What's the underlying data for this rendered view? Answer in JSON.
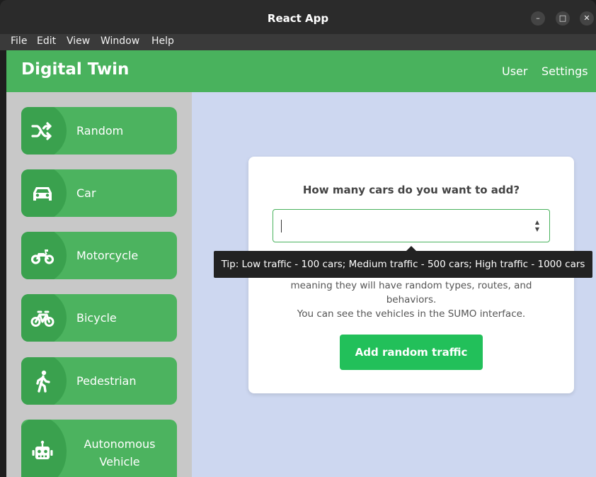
{
  "window": {
    "title": "React App"
  },
  "menu": [
    "File",
    "Edit",
    "View",
    "Window",
    "Help"
  ],
  "header": {
    "brand": "Digital Twin",
    "nav": [
      "User",
      "Settings"
    ]
  },
  "sidebar": {
    "items": [
      {
        "label": "Random",
        "icon": "shuffle-icon"
      },
      {
        "label": "Car",
        "icon": "car-icon"
      },
      {
        "label": "Motorcycle",
        "icon": "motorcycle-icon"
      },
      {
        "label": "Bicycle",
        "icon": "bicycle-icon"
      },
      {
        "label": "Pedestrian",
        "icon": "walking-person-icon"
      },
      {
        "label": "Autonomous Vehicle",
        "icon": "robot-icon"
      }
    ]
  },
  "card": {
    "question": "How many cars do you want to add?",
    "input_value": "",
    "tooltip": "Tip: Low traffic - 100 cars; Medium traffic - 500 cars; High traffic - 1000 cars",
    "description_line1": "meaning they will have random types, routes, and",
    "description_line2": "behaviors.",
    "description_line3": "You can see the vehicles in the SUMO interface.",
    "button_label": "Add random traffic"
  },
  "colors": {
    "brand_green": "#49b25d",
    "button_green": "#22c05a",
    "main_bg": "#cdd7f0",
    "sidebar_bg": "#c8c8c8"
  }
}
